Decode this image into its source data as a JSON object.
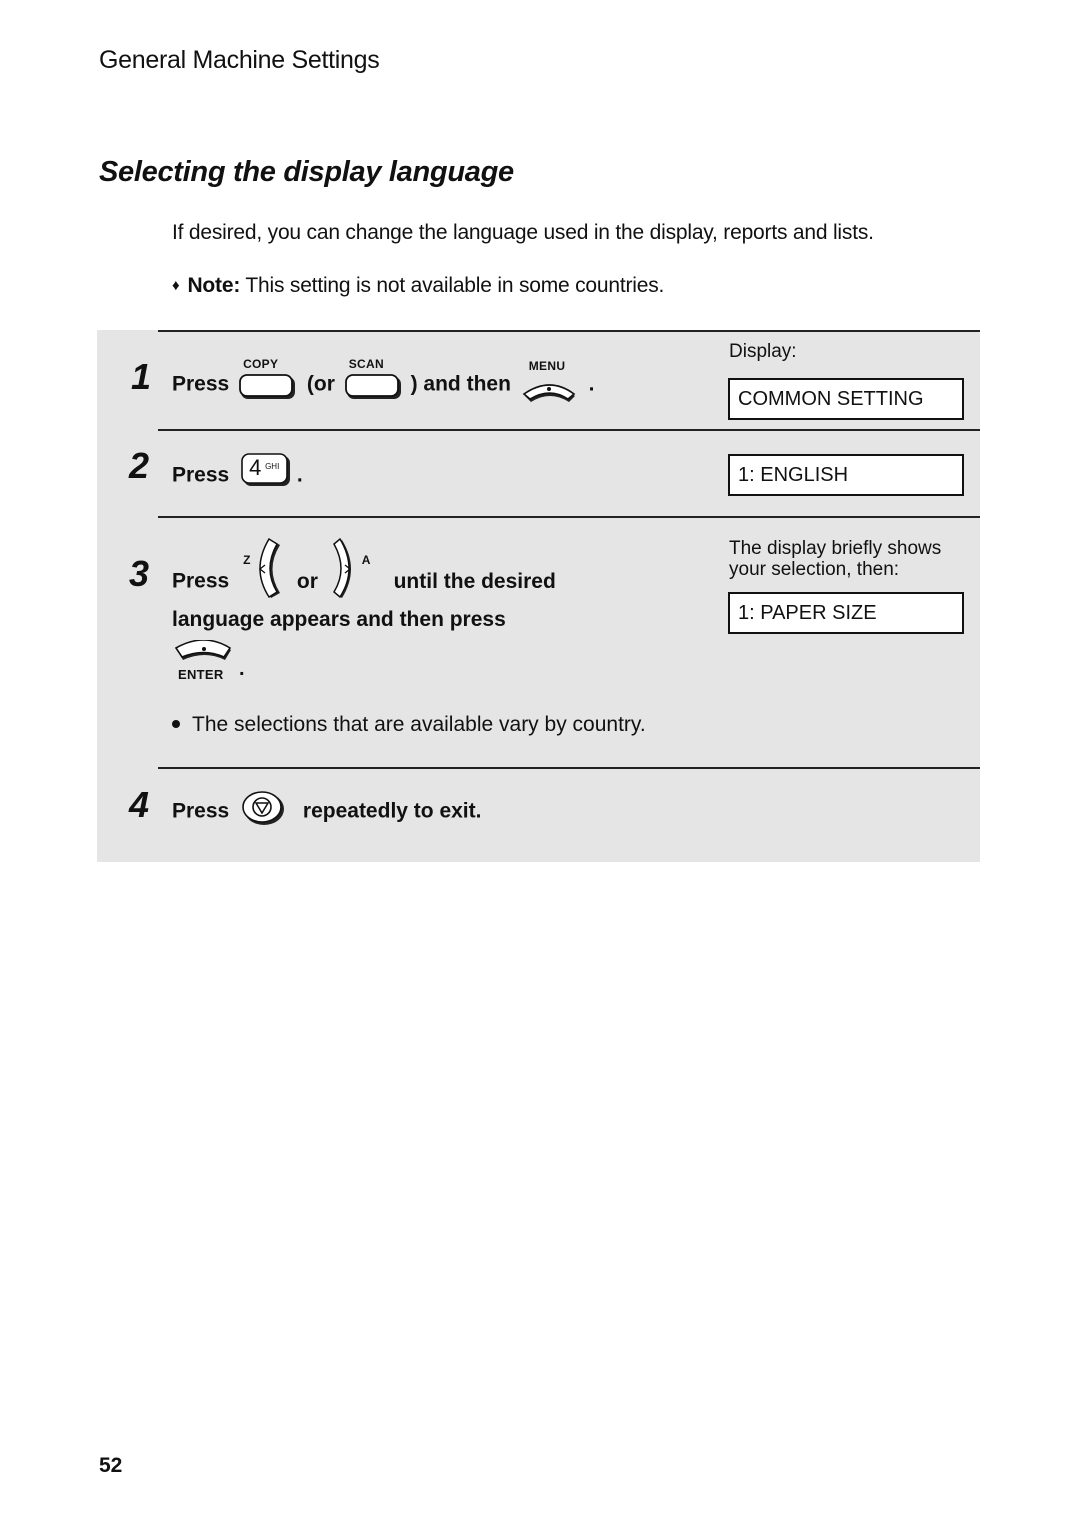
{
  "header": {
    "running_head": "General Machine Settings"
  },
  "section": {
    "title": "Selecting the display language",
    "intro": "If desired, you can change the language used in the display, reports and lists.",
    "note_label": "Note:",
    "note_text": " This setting is not available in some countries."
  },
  "steps": [
    {
      "number": "1",
      "press": "Press",
      "key1_label": "COPY",
      "or_text": "(or",
      "key2_label": "SCAN",
      "and_then": ") and then",
      "key3_label": "MENU",
      "period": ".",
      "display_label": "Display:",
      "display_value": "COMMON SETTING"
    },
    {
      "number": "2",
      "press": "Press",
      "key_digit": "4",
      "key_letters": "GHI",
      "period": ".",
      "display_value": "1: ENGLISH"
    },
    {
      "number": "3",
      "press": "Press",
      "left_key_letter": "Z",
      "or_text": "or",
      "right_key_letter": "A",
      "line1_rest": "until the desired",
      "line2": "language appears and then press",
      "enter_label": "ENTER",
      "period": ".",
      "display_note": [
        "The display briefly shows",
        "your selection, then:"
      ],
      "display_value": "1: PAPER SIZE",
      "bullet": "The selections that are available vary by country."
    },
    {
      "number": "4",
      "press": "Press",
      "rest": "repeatedly to exit."
    }
  ],
  "icons": {
    "note_marker": "♦",
    "copy_key": "rounded-rect-key-icon",
    "scan_key": "rounded-rect-key-icon",
    "menu_key": "arc-key-icon",
    "digit_key": "number-key-icon",
    "left_arrow_key": "left-arrow-key-icon",
    "right_arrow_key": "right-arrow-key-icon",
    "enter_key": "enter-key-icon",
    "stop_key": "stop-key-icon"
  },
  "footer": {
    "page_number": "52"
  },
  "colors": {
    "panel_background": "#e5e5e5",
    "text": "#111111",
    "lcd_background": "#ffffff"
  }
}
